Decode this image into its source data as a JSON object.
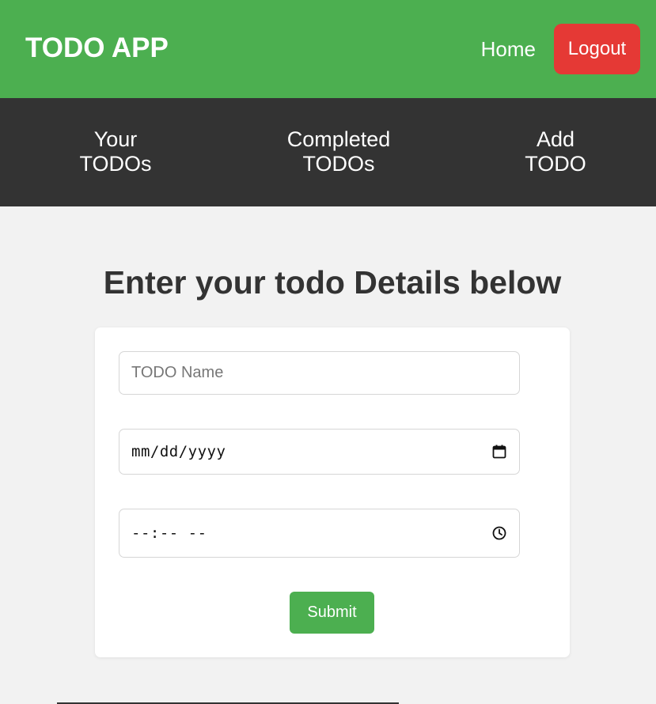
{
  "header": {
    "brand": "TODO APP",
    "home_label": "Home",
    "logout_label": "Logout"
  },
  "nav": {
    "items": [
      {
        "line1": "Your",
        "line2": "TODOs"
      },
      {
        "line1": "Completed",
        "line2": "TODOs"
      },
      {
        "line1": "Add",
        "line2": "TODO"
      }
    ]
  },
  "main": {
    "title": "Enter your todo Details below",
    "form": {
      "name_placeholder": "TODO Name",
      "date_placeholder": "mm/dd/yyyy",
      "time_placeholder": "--:-- --",
      "submit_label": "Submit"
    }
  },
  "colors": {
    "header_bg": "#4caf50",
    "logout_bg": "#e53935",
    "nav_bg": "#333333",
    "page_bg": "#f2f2f2",
    "submit_bg": "#4caf50"
  },
  "icons": {
    "date": "calendar-icon",
    "time": "clock-icon"
  }
}
